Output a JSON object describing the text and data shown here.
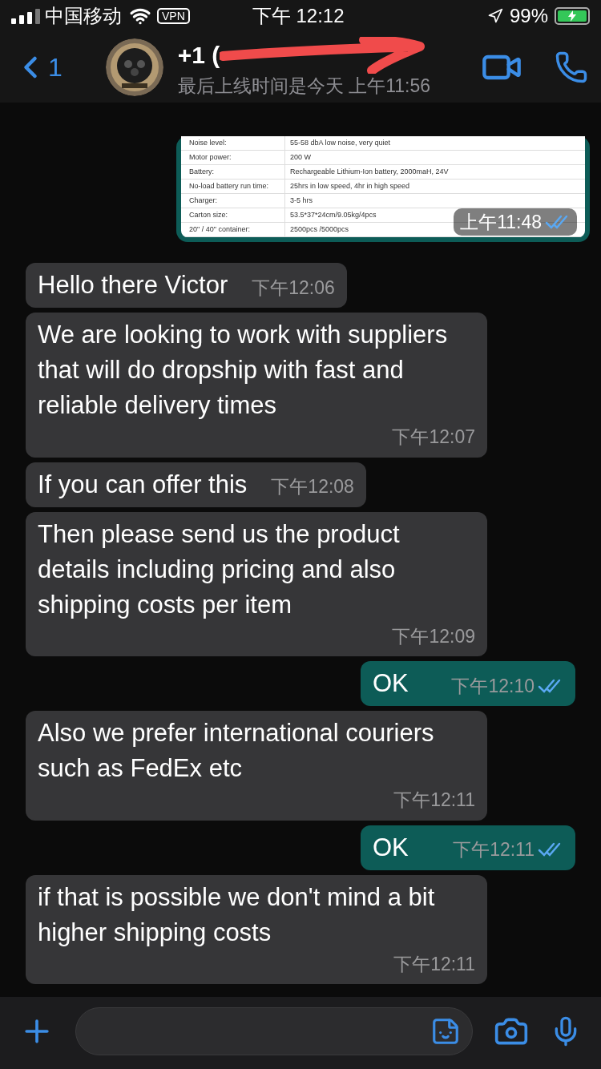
{
  "status_bar": {
    "carrier": "中国移动",
    "vpn": "VPN",
    "time": "下午 12:12",
    "battery": "99%",
    "charging": true
  },
  "header": {
    "back_count": "1",
    "title": "+1 (",
    "subtitle": "最后上线时间是今天 上午11:56",
    "redacted": true
  },
  "messages": [
    {
      "time": "上午11:48",
      "read": true,
      "table": [
        [
          "Noise level:",
          "55-58 dbA low noise, very quiet"
        ],
        [
          "Motor power:",
          "200 W"
        ],
        [
          "Battery:",
          "Rechargeable Lithium-Ion battery, 2000maH, 24V"
        ],
        [
          "No-load battery run time:",
          "25hrs in low speed, 4hr in high speed"
        ],
        [
          "Charger:",
          "3-5 hrs"
        ],
        [
          "Carton size:",
          "53.5*37*24cm/9.05kg/4pcs"
        ],
        [
          "20\" / 40\" container:",
          "2500pcs /5000pcs"
        ]
      ]
    },
    {
      "kind": "incoming",
      "text": "Hello there Victor",
      "time": "下午12:06"
    },
    {
      "kind": "incoming",
      "text": "We are looking to work with suppliers that will do dropship with fast and reliable delivery times",
      "time": "下午12:07"
    },
    {
      "kind": "incoming",
      "text": "If you can offer this",
      "time": "下午12:08"
    },
    {
      "kind": "incoming",
      "text": "Then please send us the product details including pricing and also shipping costs per item",
      "time": "下午12:09"
    },
    {
      "kind": "outgoing",
      "text": "OK",
      "time": "下午12:10",
      "read": true
    },
    {
      "kind": "incoming",
      "text": "Also we prefer international couriers such as FedEx etc",
      "time": "下午12:11"
    },
    {
      "kind": "outgoing",
      "text": "OK",
      "time": "下午12:11",
      "read": true
    },
    {
      "kind": "incoming",
      "text": "if that is possible we don't mind a bit higher shipping costs",
      "time": "下午12:11"
    }
  ]
}
